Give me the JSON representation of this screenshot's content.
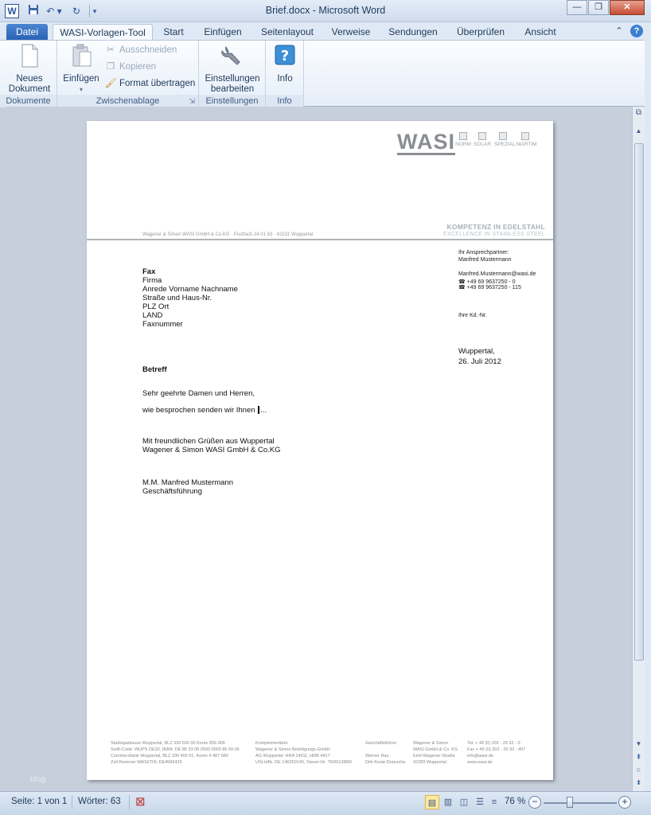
{
  "titlebar": {
    "app_icon": "W",
    "title": "Brief.docx - Microsoft Word",
    "save_icon": "floppy-icon",
    "undo_icon": "undo-icon",
    "redo_icon": "redo-icon"
  },
  "tabs": [
    "Datei",
    "WASI-Vorlagen-Tool",
    "Start",
    "Einfügen",
    "Seitenlayout",
    "Verweise",
    "Sendungen",
    "Überprüfen",
    "Ansicht"
  ],
  "ribbon": {
    "groups": {
      "dokumente": "Dokumente",
      "zwischenablage": "Zwischenablage",
      "einstellungen": "Einstellungen",
      "info": "Info"
    },
    "buttons": {
      "neues_dokument_1": "Neues",
      "neues_dokument_2": "Dokument",
      "einfuegen": "Einfügen",
      "ausschneiden": "Ausschneiden",
      "kopieren": "Kopieren",
      "format_uebertragen": "Format übertragen",
      "einstellungen_1": "Einstellungen",
      "einstellungen_2": "bearbeiten",
      "info": "Info"
    }
  },
  "letter": {
    "logo": "WASI",
    "logo_subs": [
      "NORM",
      "SOLAR",
      "SPEZIAL",
      "MARTIM"
    ],
    "kompetenz": "KOMPETENZ IN EDELSTAHL",
    "excellence": "EXCELLENCE IN STAINLESS STEEL",
    "sender_line": "Wagener & Simon WASI GmbH & Co.KG · Postfach 24 01 63 · 42231 Wuppertal",
    "recipient": [
      "Fax",
      "Firma",
      "Anrede Vorname Nachname",
      "Straße und Haus-Nr.",
      "PLZ Ort",
      "LAND",
      "Faxnummer"
    ],
    "contact_label": "Ihr Ansprechpartner:",
    "contact_name": "Manfred Mustermann",
    "contact_email": "Manfred.Mustermann@wasi.de",
    "contact_phone": "☎ +49 69 9637250 - 0",
    "contact_fax": "☎ +49 69 9637250 - 115",
    "kd_nr": "Ihre Kd.-Nr.",
    "city": "Wuppertal,",
    "date": "26. Juli 2012",
    "betreff": "Betreff",
    "salutation": "Sehr geehrte Damen und Herren,",
    "body_before": "wie besprochen senden wir Ihnen",
    "body_after": "...",
    "closing_1": "Mit freundlichen Grüßen aus Wuppertal",
    "closing_2": "Wagener & Simon WASI GmbH & Co.KG",
    "signer": "M.M. Manfred Mustermann",
    "signer_title": "Geschäftsführung",
    "footer": [
      "Stadtsparkasse Wuppertal, BLZ 330 500 00 Konto 856 906\nSwift-Code: WUPS DE33, IBAN: DE 85 33 05 0000 0000 85 69 06\nCommerzbank Wuppertal, BLZ 330 400 01, Konto 4 487 680\nZoll-Nummer WASI/TIN: DE4583426",
      "Komplementärin:\nWagener & Simon Beteiligungs-GmbH\nAG Wuppertal: HRA 14011, HRB 4417\nUSt-IdNr. DE 146250140, Steuer-Nr. 7600/1/0800",
      "Geschäftsführer:\n\nWerner Rau\nDirk Kesle-Duresche",
      "Wagener & Simon\nWASI GmbH & Co. KG\nEmil-Wagener-Straße\n42289 Wuppertal",
      "Tel. + 49 (0) 202 - 26 32 - 0\nFax + 49 (0) 202 - 26 32 - 407\ninfo@wasi.de\nwww.wasi.de"
    ]
  },
  "statusbar": {
    "page": "Seite: 1 von 1",
    "words": "Wörter: 63",
    "zoom": "76 %"
  },
  "watermark": "blog",
  "colors": {
    "accent": "#2a62b5",
    "ribbon_bg": "#e6eef8",
    "doc_bg": "#c6cfdb"
  }
}
